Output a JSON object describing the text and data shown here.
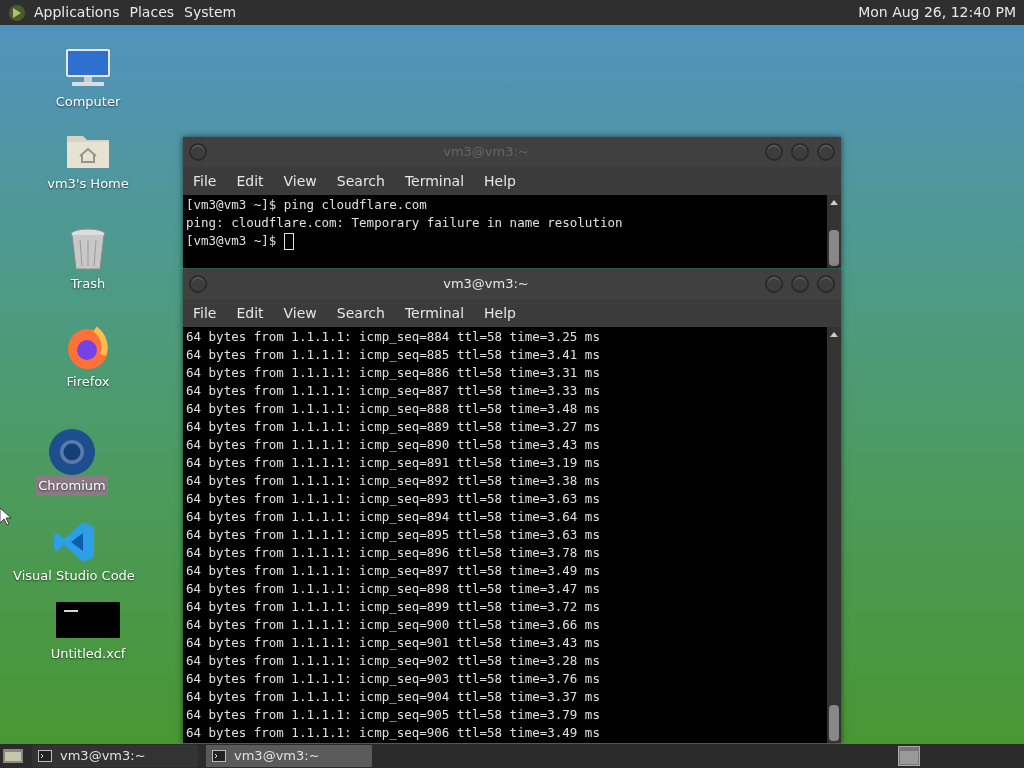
{
  "top_panel": {
    "menus": [
      "Applications",
      "Places",
      "System"
    ],
    "clock": "Mon Aug 26, 12:40 PM"
  },
  "desktop_icons": [
    {
      "label": "Computer",
      "kind": "computer",
      "selected": false
    },
    {
      "label": "vm3's Home",
      "kind": "home",
      "selected": false
    },
    {
      "label": "Trash",
      "kind": "trash",
      "selected": false
    },
    {
      "label": "Firefox",
      "kind": "firefox",
      "selected": false
    },
    {
      "label": "Chromium",
      "kind": "chromium",
      "selected": true
    },
    {
      "label": "Visual Studio Code",
      "kind": "vscode",
      "selected": false
    },
    {
      "label": "Untitled.xcf",
      "kind": "image",
      "selected": false
    }
  ],
  "windows": [
    {
      "title": "vm3@vm3:~",
      "active": false,
      "cursor": true,
      "menu": [
        "File",
        "Edit",
        "View",
        "Search",
        "Terminal",
        "Help"
      ],
      "lines": [
        "[vm3@vm3 ~]$ ping cloudflare.com",
        "ping: cloudflare.com: Temporary failure in name resolution",
        "[vm3@vm3 ~]$ "
      ]
    },
    {
      "title": "vm3@vm3:~",
      "active": true,
      "cursor": false,
      "menu": [
        "File",
        "Edit",
        "View",
        "Search",
        "Terminal",
        "Help"
      ],
      "lines": [
        "64 bytes from 1.1.1.1: icmp_seq=884 ttl=58 time=3.25 ms",
        "64 bytes from 1.1.1.1: icmp_seq=885 ttl=58 time=3.41 ms",
        "64 bytes from 1.1.1.1: icmp_seq=886 ttl=58 time=3.31 ms",
        "64 bytes from 1.1.1.1: icmp_seq=887 ttl=58 time=3.33 ms",
        "64 bytes from 1.1.1.1: icmp_seq=888 ttl=58 time=3.48 ms",
        "64 bytes from 1.1.1.1: icmp_seq=889 ttl=58 time=3.27 ms",
        "64 bytes from 1.1.1.1: icmp_seq=890 ttl=58 time=3.43 ms",
        "64 bytes from 1.1.1.1: icmp_seq=891 ttl=58 time=3.19 ms",
        "64 bytes from 1.1.1.1: icmp_seq=892 ttl=58 time=3.38 ms",
        "64 bytes from 1.1.1.1: icmp_seq=893 ttl=58 time=3.63 ms",
        "64 bytes from 1.1.1.1: icmp_seq=894 ttl=58 time=3.64 ms",
        "64 bytes from 1.1.1.1: icmp_seq=895 ttl=58 time=3.63 ms",
        "64 bytes from 1.1.1.1: icmp_seq=896 ttl=58 time=3.78 ms",
        "64 bytes from 1.1.1.1: icmp_seq=897 ttl=58 time=3.49 ms",
        "64 bytes from 1.1.1.1: icmp_seq=898 ttl=58 time=3.47 ms",
        "64 bytes from 1.1.1.1: icmp_seq=899 ttl=58 time=3.72 ms",
        "64 bytes from 1.1.1.1: icmp_seq=900 ttl=58 time=3.66 ms",
        "64 bytes from 1.1.1.1: icmp_seq=901 ttl=58 time=3.43 ms",
        "64 bytes from 1.1.1.1: icmp_seq=902 ttl=58 time=3.28 ms",
        "64 bytes from 1.1.1.1: icmp_seq=903 ttl=58 time=3.76 ms",
        "64 bytes from 1.1.1.1: icmp_seq=904 ttl=58 time=3.37 ms",
        "64 bytes from 1.1.1.1: icmp_seq=905 ttl=58 time=3.79 ms",
        "64 bytes from 1.1.1.1: icmp_seq=906 ttl=58 time=3.49 ms"
      ]
    }
  ],
  "taskbar": {
    "tasks": [
      {
        "label": "vm3@vm3:~",
        "selected": false
      },
      {
        "label": "vm3@vm3:~",
        "selected": true
      }
    ]
  }
}
